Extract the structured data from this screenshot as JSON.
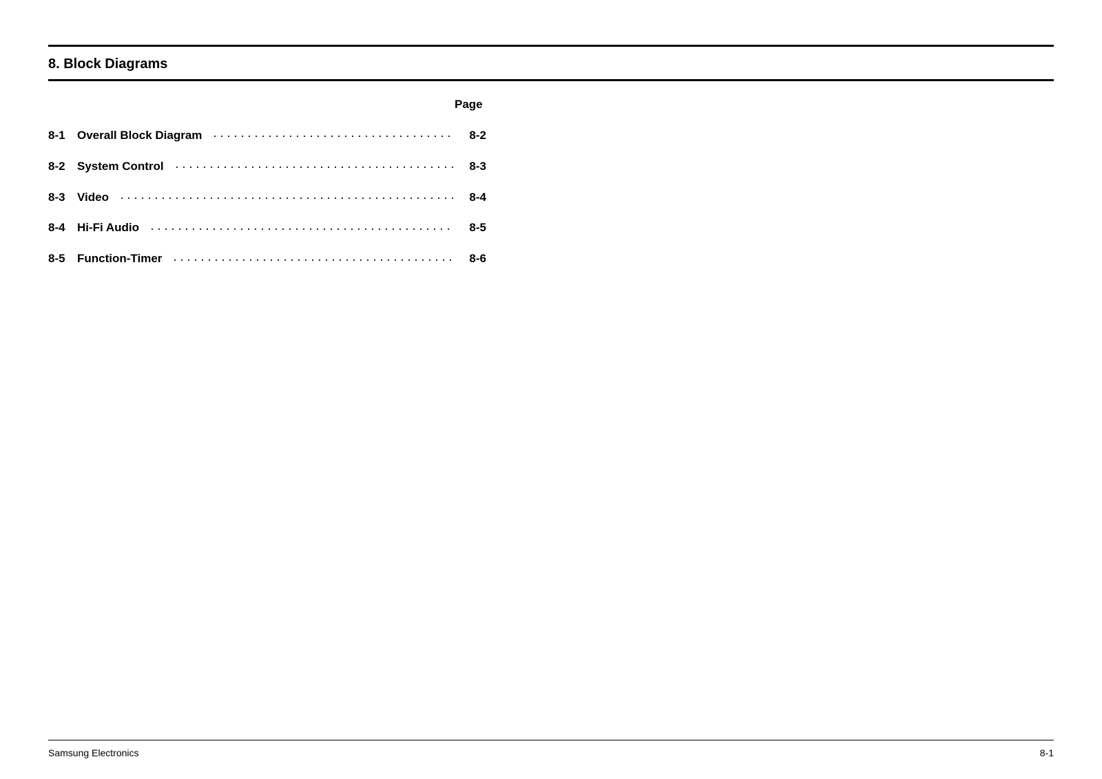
{
  "section_title": "8. Block Diagrams",
  "page_column_header": "Page",
  "toc": [
    {
      "index": "8-1",
      "title": "Overall Block Diagram",
      "page": "8-2"
    },
    {
      "index": "8-2",
      "title": "System Control",
      "page": "8-3"
    },
    {
      "index": "8-3",
      "title": "Video",
      "page": "8-4"
    },
    {
      "index": "8-4",
      "title": "Hi-Fi Audio",
      "page": "8-5"
    },
    {
      "index": "8-5",
      "title": "Function-Timer",
      "page": "8-6"
    }
  ],
  "footer": {
    "left": "Samsung Electronics",
    "right": "8-1"
  }
}
